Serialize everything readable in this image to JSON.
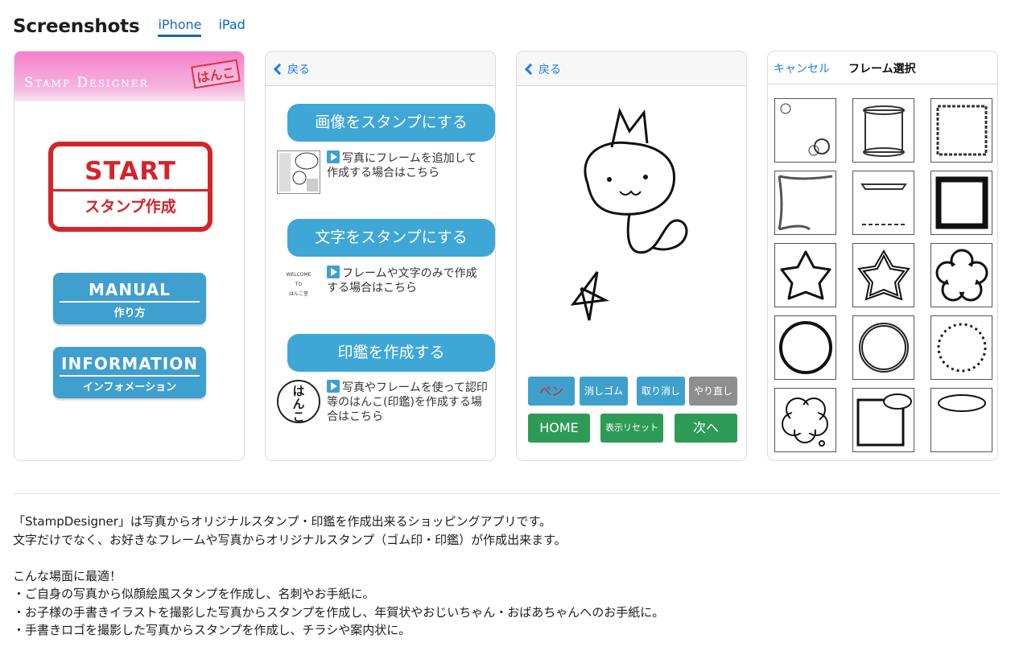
{
  "header": {
    "title": "Screenshots",
    "tabs": [
      {
        "label": "iPhone",
        "active": true
      },
      {
        "label": "iPad",
        "active": false
      }
    ]
  },
  "shot1": {
    "logo": "Stamp Designer",
    "hanko": "はんこ",
    "start_big": "START",
    "start_small": "スタンプ作成",
    "manual_big": "MANUAL",
    "manual_small": "作り方",
    "info_big": "INFORMATION",
    "info_small": "インフォメーション"
  },
  "shot2": {
    "back": "戻る",
    "button1": "画像をスタンプにする",
    "desc1": "写真にフレームを追加して作成する場合はこちら",
    "button2": "文字をスタンプにする",
    "desc2": "フレームや文字のみで作成する場合はこちら",
    "button3": "印鑑を作成する",
    "desc3": "写真やフレームを使って認印等のはんこ(印鑑)を作成する場合はこちら",
    "welcome": [
      "WELCOME",
      "TO",
      "はんこ堂"
    ],
    "hanko_chars": "はんこ"
  },
  "shot3": {
    "back": "戻る",
    "pen": "ペン",
    "eraser": "消しゴム",
    "undo": "取り消し",
    "redo": "やり直し",
    "home": "HOME",
    "reset": "表示リセット",
    "next": "次へ"
  },
  "shot4": {
    "cancel": "キャンセル",
    "title": "フレーム選択",
    "frames": [
      "floral-corner",
      "scroll",
      "grunge-square",
      "lace-corner",
      "ribbon-banner",
      "bold-grunge-square",
      "sakura",
      "double-sakura",
      "plum-flower",
      "circle",
      "sketch-circle",
      "music-note-circle",
      "cloud-bubble",
      "comic-square-bubble",
      "speech-bubble"
    ]
  },
  "description": [
    "「StampDesigner」は写真からオリジナルスタンプ・印鑑を作成出来るショッピングアプリです。",
    "文字だけでなく、お好きなフレームや写真からオリジナルスタンプ（ゴム印・印鑑）が作成出来ます。",
    "",
    "こんな場面に最適！",
    "・ご自身の写真から似顔絵風スタンプを作成し、名刺やお手紙に。",
    "・お子様の手書きイラストを撮影した写真からスタンプを作成し、年賀状やおじいちゃん・おばあちゃんへのお手紙に。",
    "・手書きロゴを撮影した写真からスタンプを作成し、チラシや案内状に。"
  ],
  "colors": {
    "tab_active": "#1d64b5",
    "link": "#1a7df0",
    "stamp_red": "#d3242c",
    "button_blue": "#3f9fce",
    "button_green": "#2d9b55"
  }
}
